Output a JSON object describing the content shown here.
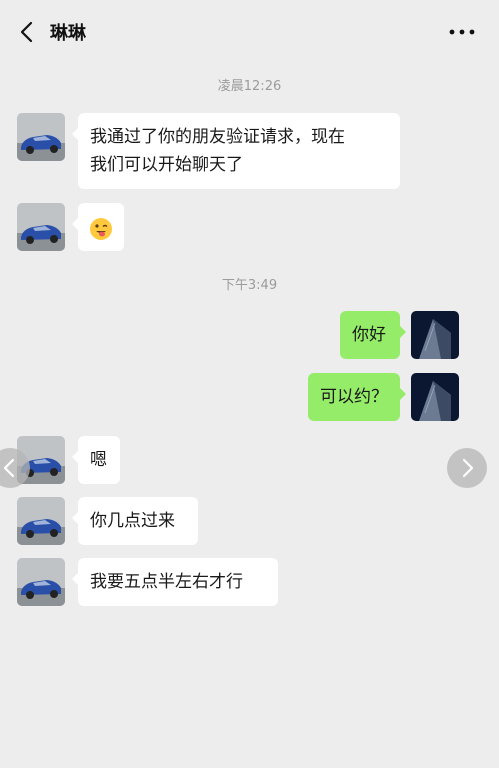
{
  "header": {
    "title": "琳琳",
    "back_icon": "chevron-left-icon",
    "more_icon": "more-dots-icon"
  },
  "timestamps": [
    "凌晨12:26",
    "下午3:49"
  ],
  "messages": [
    {
      "side": "left",
      "lines": [
        "我通过了你的朋友验证请求，现在",
        "我们可以开始聊天了"
      ]
    },
    {
      "side": "left",
      "emoji": "winking-tongue-face-emoji"
    },
    {
      "side": "right",
      "text": "你好"
    },
    {
      "side": "right",
      "text": "可以约？"
    },
    {
      "side": "left",
      "text": "嗯"
    },
    {
      "side": "left",
      "text": "你几点过来"
    },
    {
      "side": "left",
      "text": "我要五点半左右才行"
    }
  ],
  "colors": {
    "background": "#EDEDED",
    "bubble_left": "#FFFFFF",
    "bubble_right": "#95EC69",
    "timestamp": "#9B9B9B"
  },
  "overlay": {
    "prev_icon": "chevron-left-icon",
    "next_icon": "chevron-right-icon"
  }
}
